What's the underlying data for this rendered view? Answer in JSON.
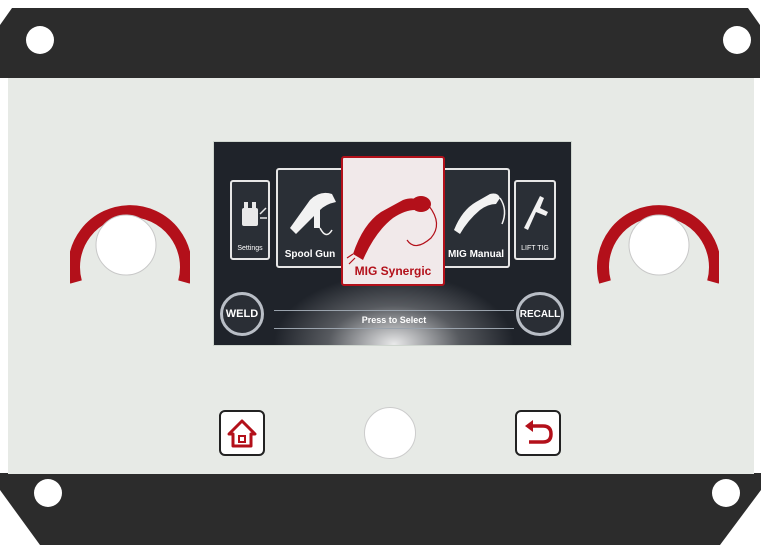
{
  "screen": {
    "modes": [
      {
        "label": "Settings"
      },
      {
        "label": "Spool Gun"
      },
      {
        "label": "MIG Synergic"
      },
      {
        "label": "MIG Manual"
      },
      {
        "label": "LIFT TIG"
      }
    ],
    "weld_label": "WELD",
    "recall_label": "RECALL",
    "prompt": "Press to Select"
  },
  "colors": {
    "accent": "#b3101a",
    "selected_card": "#f1e9ea",
    "frame": "#2c2c2c",
    "panel": "#e7eae6"
  },
  "icons": {
    "home": "home-icon",
    "back": "return-arrow-icon"
  }
}
